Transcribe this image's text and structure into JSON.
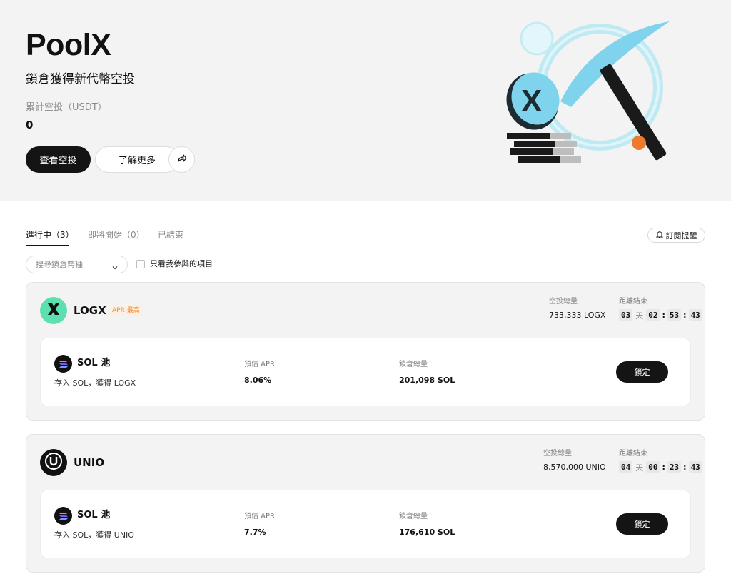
{
  "hero": {
    "title": "PoolX",
    "subtitle": "鎖倉獲得新代幣空投",
    "total_label": "累計空投（USDT）",
    "total_value": "0",
    "view_airdrop_btn": "查看空投",
    "learn_more_btn": "了解更多",
    "share_icon": "share-arrow-icon",
    "art_icon": "x-coin-pickaxe-illustration"
  },
  "tabs": [
    {
      "label": "進行中（3）",
      "active": true
    },
    {
      "label": "即將開始（0）",
      "active": false
    },
    {
      "label": "已結束",
      "active": false
    }
  ],
  "reminder": {
    "label": "訂閱提醒",
    "icon": "bell-icon"
  },
  "filters": {
    "search_placeholder": "搜尋鎖倉幣種",
    "only_mine_label": "只看我參與的項目",
    "only_mine_checked": false
  },
  "projects": [
    {
      "name": "LOGX",
      "badge": "APR 最高",
      "logo_color": "#5ce0b0",
      "logo_icon": "logx-x-icon",
      "airdrop_label": "空投總量",
      "airdrop_value": "733,333 LOGX",
      "countdown_label": "距離結束",
      "countdown": {
        "days": "03",
        "day_unit": "天",
        "hours": "02",
        "minutes": "53",
        "seconds": "43"
      },
      "pool": {
        "name": "SOL 池",
        "desc": "存入 SOL，獲得 LOGX",
        "apr_label": "預估 APR",
        "apr_value": "8.06%",
        "locked_label": "鎖倉總量",
        "locked_value": "201,098 SOL",
        "button": "鎖定"
      }
    },
    {
      "name": "UNIO",
      "badge": "",
      "logo_color": "#111111",
      "logo_icon": "unio-u-icon",
      "airdrop_label": "空投總量",
      "airdrop_value": "8,570,000 UNIO",
      "countdown_label": "距離結束",
      "countdown": {
        "days": "04",
        "day_unit": "天",
        "hours": "00",
        "minutes": "23",
        "seconds": "43"
      },
      "pool": {
        "name": "SOL 池",
        "desc": "存入 SOL，獲得 UNIO",
        "apr_label": "預估 APR",
        "apr_value": "7.7%",
        "locked_label": "鎖倉總量",
        "locked_value": "176,610 SOL",
        "button": "鎖定"
      }
    }
  ]
}
